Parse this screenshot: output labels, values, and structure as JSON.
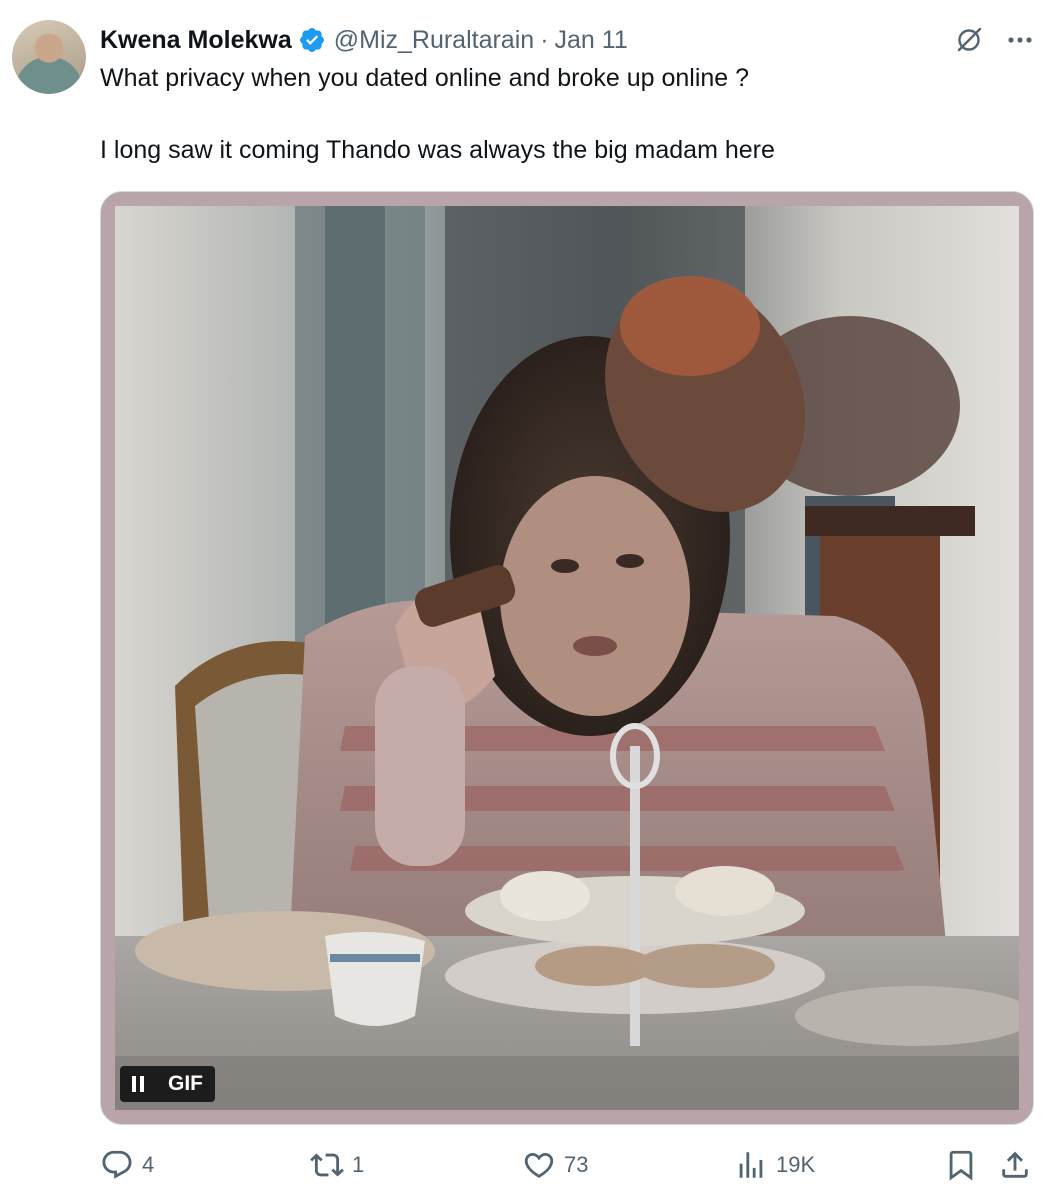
{
  "author": {
    "name": "Kwena Molekwa",
    "handle": "@Miz_Ruraltarain",
    "separator": "·",
    "date": "Jan 11"
  },
  "tweet": {
    "line1": "What privacy when you dated online and broke up online ?",
    "line2": "I long saw it coming Thando was always the big madam here"
  },
  "media": {
    "badge": "GIF"
  },
  "actions": {
    "replies": "4",
    "reposts": "1",
    "likes": "73",
    "views": "19K"
  },
  "icons": {
    "verified": "verified-badge-icon",
    "grok": "grok-icon",
    "more": "more-icon",
    "reply": "reply-icon",
    "repost": "repost-icon",
    "like": "like-icon",
    "views": "views-icon",
    "bookmark": "bookmark-icon",
    "share": "share-icon",
    "pause": "pause-icon"
  },
  "colors": {
    "text": "#0f1419",
    "secondary": "#536471",
    "verified": "#1d9bf0",
    "media_border": "#b8a4a9"
  }
}
